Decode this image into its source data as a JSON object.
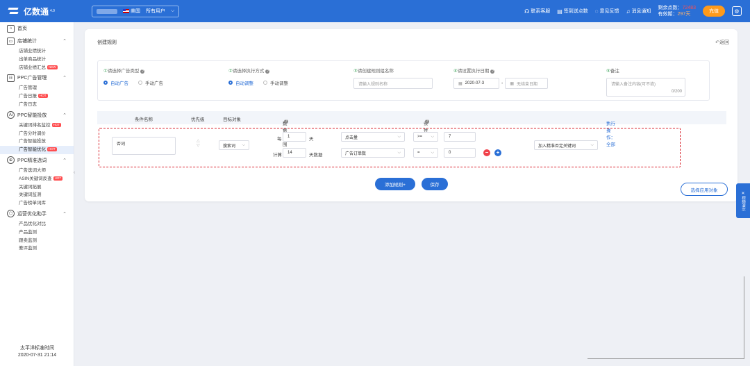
{
  "topbar": {
    "app_name": "亿数通",
    "app_version": "4.0",
    "country": "美国",
    "user_filter": "所有用户",
    "links": [
      {
        "label": "联系客服",
        "icon": "headset-icon"
      },
      {
        "label": "签到送点数",
        "icon": "calendar-icon"
      },
      {
        "label": "意见反馈",
        "icon": "chat-icon"
      },
      {
        "label": "消息通知",
        "icon": "bell-icon"
      }
    ],
    "points_label": "剩余点数：",
    "points_value": "72483",
    "validity_label": "有效期：",
    "validity_value": "297天",
    "recharge_label": "充值"
  },
  "sidebar": {
    "home": "首页",
    "groups": [
      {
        "title": "店铺统计",
        "items": [
          {
            "label": "店铺业绩统计"
          },
          {
            "label": "出单商品统计"
          },
          {
            "label": "店铺业绩汇总",
            "badge": "NEW"
          }
        ]
      },
      {
        "title": "PPC广告管理",
        "items": [
          {
            "label": "广告管理"
          },
          {
            "label": "广告日报",
            "badge": "HOT"
          },
          {
            "label": "广告日志"
          }
        ]
      },
      {
        "title": "PPC智能投放",
        "items": [
          {
            "label": "关键词排名监控",
            "badge": "HOT"
          },
          {
            "label": "广告分时调价"
          },
          {
            "label": "广告智能投放"
          },
          {
            "label": "广告智能优化",
            "badge": "HOT",
            "active": true
          }
        ]
      },
      {
        "title": "PPC精准选词",
        "items": [
          {
            "label": "广告选词大师"
          },
          {
            "label": "ASIN关键词反查",
            "badge": "HOT"
          },
          {
            "label": "关键词拓展"
          },
          {
            "label": "关键词监测"
          },
          {
            "label": "广告榜单词库"
          }
        ]
      },
      {
        "title": "运营优化助手",
        "items": [
          {
            "label": "产品优化对比"
          },
          {
            "label": "产品监测"
          },
          {
            "label": "跟卖监测"
          },
          {
            "label": "差评监测"
          }
        ]
      }
    ],
    "timezone_label": "太平洋标准时间",
    "timezone_time": "2020-07-31 21:14"
  },
  "main": {
    "title": "创建规则",
    "back": "返回",
    "steps": {
      "s1": {
        "num": "①",
        "title": "请选择广告类型",
        "opt1": "自动广告",
        "opt2": "手动广告"
      },
      "s2": {
        "num": "②",
        "title": "请选择执行方式",
        "opt1": "自动调整",
        "opt2": "手动调整"
      },
      "s3": {
        "num": "③",
        "title": "请创建规则组名称",
        "placeholder": "请输入规则名称"
      },
      "s4": {
        "num": "④",
        "title": "请设置执行日期",
        "start": "2020-07-3",
        "sep": "-",
        "end_placeholder": "无结束日期"
      },
      "s5": {
        "num": "⑤",
        "title": "备注",
        "placeholder": "请输入备注内容(可不填)",
        "counter": "0/200"
      }
    },
    "table": {
      "headers": {
        "cond_name": "条件名称",
        "priority": "优先级",
        "target": "目标对象",
        "data_range": "数据范围",
        "condition": "条件",
        "action": "执行操作：全部"
      },
      "row": {
        "name": "否词",
        "target": "搜索词",
        "every_label": "每",
        "every_value": "1",
        "day_unit": "天",
        "calc_label": "计算",
        "calc_value": "14",
        "calc_unit": "天数据",
        "metric1": "点击量",
        "op1": ">=",
        "val1": "7",
        "metric2": "广告订单数",
        "op2": "=",
        "val2": "0",
        "action": "加入精准否定关键词"
      }
    },
    "add_rule": "添加规则+",
    "save": "保存",
    "apply_target": "选择应用对象"
  },
  "side_tab": "视频演示"
}
